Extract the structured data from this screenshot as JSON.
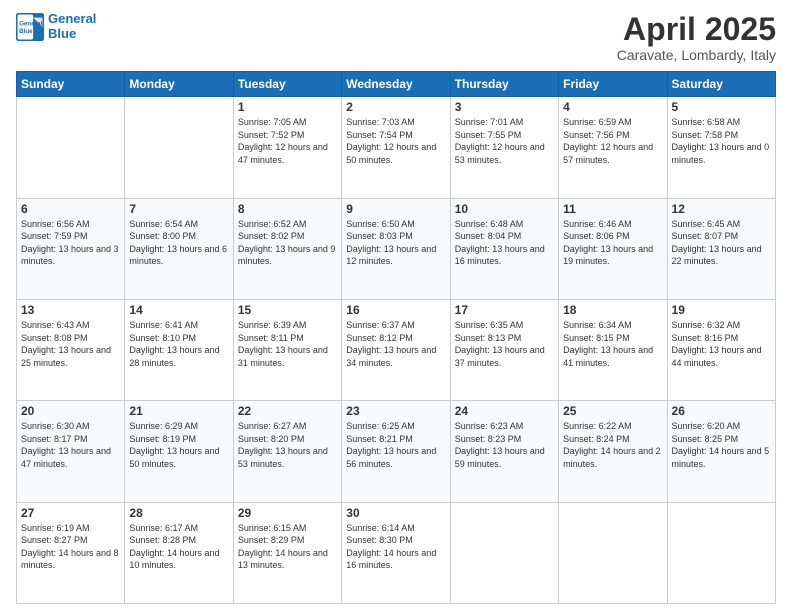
{
  "header": {
    "logo_line1": "General",
    "logo_line2": "Blue",
    "month": "April 2025",
    "location": "Caravate, Lombardy, Italy"
  },
  "weekdays": [
    "Sunday",
    "Monday",
    "Tuesday",
    "Wednesday",
    "Thursday",
    "Friday",
    "Saturday"
  ],
  "weeks": [
    [
      {
        "day": "",
        "sunrise": "",
        "sunset": "",
        "daylight": ""
      },
      {
        "day": "",
        "sunrise": "",
        "sunset": "",
        "daylight": ""
      },
      {
        "day": "1",
        "sunrise": "Sunrise: 7:05 AM",
        "sunset": "Sunset: 7:52 PM",
        "daylight": "Daylight: 12 hours and 47 minutes."
      },
      {
        "day": "2",
        "sunrise": "Sunrise: 7:03 AM",
        "sunset": "Sunset: 7:54 PM",
        "daylight": "Daylight: 12 hours and 50 minutes."
      },
      {
        "day": "3",
        "sunrise": "Sunrise: 7:01 AM",
        "sunset": "Sunset: 7:55 PM",
        "daylight": "Daylight: 12 hours and 53 minutes."
      },
      {
        "day": "4",
        "sunrise": "Sunrise: 6:59 AM",
        "sunset": "Sunset: 7:56 PM",
        "daylight": "Daylight: 12 hours and 57 minutes."
      },
      {
        "day": "5",
        "sunrise": "Sunrise: 6:58 AM",
        "sunset": "Sunset: 7:58 PM",
        "daylight": "Daylight: 13 hours and 0 minutes."
      }
    ],
    [
      {
        "day": "6",
        "sunrise": "Sunrise: 6:56 AM",
        "sunset": "Sunset: 7:59 PM",
        "daylight": "Daylight: 13 hours and 3 minutes."
      },
      {
        "day": "7",
        "sunrise": "Sunrise: 6:54 AM",
        "sunset": "Sunset: 8:00 PM",
        "daylight": "Daylight: 13 hours and 6 minutes."
      },
      {
        "day": "8",
        "sunrise": "Sunrise: 6:52 AM",
        "sunset": "Sunset: 8:02 PM",
        "daylight": "Daylight: 13 hours and 9 minutes."
      },
      {
        "day": "9",
        "sunrise": "Sunrise: 6:50 AM",
        "sunset": "Sunset: 8:03 PM",
        "daylight": "Daylight: 13 hours and 12 minutes."
      },
      {
        "day": "10",
        "sunrise": "Sunrise: 6:48 AM",
        "sunset": "Sunset: 8:04 PM",
        "daylight": "Daylight: 13 hours and 16 minutes."
      },
      {
        "day": "11",
        "sunrise": "Sunrise: 6:46 AM",
        "sunset": "Sunset: 8:06 PM",
        "daylight": "Daylight: 13 hours and 19 minutes."
      },
      {
        "day": "12",
        "sunrise": "Sunrise: 6:45 AM",
        "sunset": "Sunset: 8:07 PM",
        "daylight": "Daylight: 13 hours and 22 minutes."
      }
    ],
    [
      {
        "day": "13",
        "sunrise": "Sunrise: 6:43 AM",
        "sunset": "Sunset: 8:08 PM",
        "daylight": "Daylight: 13 hours and 25 minutes."
      },
      {
        "day": "14",
        "sunrise": "Sunrise: 6:41 AM",
        "sunset": "Sunset: 8:10 PM",
        "daylight": "Daylight: 13 hours and 28 minutes."
      },
      {
        "day": "15",
        "sunrise": "Sunrise: 6:39 AM",
        "sunset": "Sunset: 8:11 PM",
        "daylight": "Daylight: 13 hours and 31 minutes."
      },
      {
        "day": "16",
        "sunrise": "Sunrise: 6:37 AM",
        "sunset": "Sunset: 8:12 PM",
        "daylight": "Daylight: 13 hours and 34 minutes."
      },
      {
        "day": "17",
        "sunrise": "Sunrise: 6:35 AM",
        "sunset": "Sunset: 8:13 PM",
        "daylight": "Daylight: 13 hours and 37 minutes."
      },
      {
        "day": "18",
        "sunrise": "Sunrise: 6:34 AM",
        "sunset": "Sunset: 8:15 PM",
        "daylight": "Daylight: 13 hours and 41 minutes."
      },
      {
        "day": "19",
        "sunrise": "Sunrise: 6:32 AM",
        "sunset": "Sunset: 8:16 PM",
        "daylight": "Daylight: 13 hours and 44 minutes."
      }
    ],
    [
      {
        "day": "20",
        "sunrise": "Sunrise: 6:30 AM",
        "sunset": "Sunset: 8:17 PM",
        "daylight": "Daylight: 13 hours and 47 minutes."
      },
      {
        "day": "21",
        "sunrise": "Sunrise: 6:29 AM",
        "sunset": "Sunset: 8:19 PM",
        "daylight": "Daylight: 13 hours and 50 minutes."
      },
      {
        "day": "22",
        "sunrise": "Sunrise: 6:27 AM",
        "sunset": "Sunset: 8:20 PM",
        "daylight": "Daylight: 13 hours and 53 minutes."
      },
      {
        "day": "23",
        "sunrise": "Sunrise: 6:25 AM",
        "sunset": "Sunset: 8:21 PM",
        "daylight": "Daylight: 13 hours and 56 minutes."
      },
      {
        "day": "24",
        "sunrise": "Sunrise: 6:23 AM",
        "sunset": "Sunset: 8:23 PM",
        "daylight": "Daylight: 13 hours and 59 minutes."
      },
      {
        "day": "25",
        "sunrise": "Sunrise: 6:22 AM",
        "sunset": "Sunset: 8:24 PM",
        "daylight": "Daylight: 14 hours and 2 minutes."
      },
      {
        "day": "26",
        "sunrise": "Sunrise: 6:20 AM",
        "sunset": "Sunset: 8:25 PM",
        "daylight": "Daylight: 14 hours and 5 minutes."
      }
    ],
    [
      {
        "day": "27",
        "sunrise": "Sunrise: 6:19 AM",
        "sunset": "Sunset: 8:27 PM",
        "daylight": "Daylight: 14 hours and 8 minutes."
      },
      {
        "day": "28",
        "sunrise": "Sunrise: 6:17 AM",
        "sunset": "Sunset: 8:28 PM",
        "daylight": "Daylight: 14 hours and 10 minutes."
      },
      {
        "day": "29",
        "sunrise": "Sunrise: 6:15 AM",
        "sunset": "Sunset: 8:29 PM",
        "daylight": "Daylight: 14 hours and 13 minutes."
      },
      {
        "day": "30",
        "sunrise": "Sunrise: 6:14 AM",
        "sunset": "Sunset: 8:30 PM",
        "daylight": "Daylight: 14 hours and 16 minutes."
      },
      {
        "day": "",
        "sunrise": "",
        "sunset": "",
        "daylight": ""
      },
      {
        "day": "",
        "sunrise": "",
        "sunset": "",
        "daylight": ""
      },
      {
        "day": "",
        "sunrise": "",
        "sunset": "",
        "daylight": ""
      }
    ]
  ]
}
